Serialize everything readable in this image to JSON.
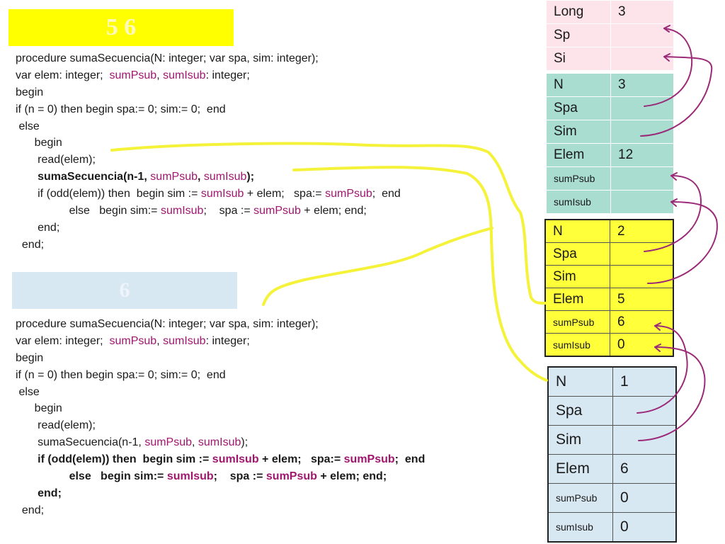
{
  "headings": {
    "top": "5  6",
    "bottom": "6"
  },
  "code_top": [
    [
      {
        "t": "procedure sumaSecuencia(N: integer; var spa, sim: integer);"
      }
    ],
    [
      {
        "t": "var elem: integer;  "
      },
      {
        "t": "sumPsub",
        "k": 1
      },
      {
        "t": ", "
      },
      {
        "t": "sumIsub",
        "k": 1
      },
      {
        "t": ": integer;"
      }
    ],
    [
      {
        "t": "begin"
      }
    ],
    [
      {
        "t": "if (n = 0) then begin spa:= 0; sim:= 0;  end"
      }
    ],
    [
      {
        "t": " else"
      }
    ],
    [
      {
        "t": "      begin"
      }
    ],
    [
      {
        "t": "       read(elem);"
      }
    ],
    [
      {
        "t": "       "
      },
      {
        "t": "sumaSecuencia(n-1, ",
        "b": 1
      },
      {
        "t": "sumPsub",
        "k": 1
      },
      {
        "t": ", ",
        "b": 1
      },
      {
        "t": "sumIsub",
        "k": 1
      },
      {
        "t": ");",
        "b": 1
      }
    ],
    [
      {
        "t": "       if (odd(elem)) then  begin sim := "
      },
      {
        "t": "sumIsub",
        "k": 1
      },
      {
        "t": " + elem;   spa:= "
      },
      {
        "t": "sumPsub",
        "k": 1
      },
      {
        "t": ";  end"
      }
    ],
    [
      {
        "t": "                 else   begin sim:= "
      },
      {
        "t": "sumIsub",
        "k": 1
      },
      {
        "t": ";    spa := "
      },
      {
        "t": "sumPsub",
        "k": 1
      },
      {
        "t": " + elem; end;"
      }
    ],
    [
      {
        "t": "       end;"
      }
    ],
    [
      {
        "t": "  end;"
      }
    ]
  ],
  "code_bottom": [
    [
      {
        "t": "procedure sumaSecuencia(N: integer; var spa, sim: integer);"
      }
    ],
    [
      {
        "t": "var elem: integer;  "
      },
      {
        "t": "sumPsub",
        "k": 1
      },
      {
        "t": ", "
      },
      {
        "t": "sumIsub",
        "k": 1
      },
      {
        "t": ": integer;"
      }
    ],
    [
      {
        "t": "begin"
      }
    ],
    [
      {
        "t": "if (n = 0) then begin spa:= 0; sim:= 0;  end"
      }
    ],
    [
      {
        "t": " else"
      }
    ],
    [
      {
        "t": "      begin"
      }
    ],
    [
      {
        "t": "       read(elem);"
      }
    ],
    [
      {
        "t": "       sumaSecuencia(n-1, "
      },
      {
        "t": "sumPsub",
        "k": 1
      },
      {
        "t": ", "
      },
      {
        "t": "sumIsub",
        "k": 1
      },
      {
        "t": ");"
      }
    ],
    [
      {
        "t": "       if (odd(elem)) then  begin sim := ",
        "b": 1
      },
      {
        "t": "sumIsub",
        "k": 1,
        "b": 1
      },
      {
        "t": " + elem;   spa:= ",
        "b": 1
      },
      {
        "t": "sumPsub",
        "k": 1,
        "b": 1
      },
      {
        "t": ";  end",
        "b": 1
      }
    ],
    [
      {
        "t": "                 else   begin sim:= ",
        "b": 1
      },
      {
        "t": "sumIsub",
        "k": 1,
        "b": 1
      },
      {
        "t": ";    spa := ",
        "b": 1
      },
      {
        "t": "sumPsub",
        "k": 1,
        "b": 1
      },
      {
        "t": " + elem; end;",
        "b": 1
      }
    ],
    [
      {
        "t": "       end;",
        "b": 1
      }
    ],
    [
      {
        "t": "  end;"
      }
    ]
  ],
  "table_long": [
    {
      "name": "Long",
      "value": "3"
    },
    {
      "name": "Sp",
      "value": ""
    },
    {
      "name": "Si",
      "value": ""
    }
  ],
  "table_n3": [
    {
      "name": "N",
      "value": "3"
    },
    {
      "name": "Spa",
      "value": ""
    },
    {
      "name": "Sim",
      "value": ""
    },
    {
      "name": "Elem",
      "value": "12"
    },
    {
      "name": "sumPsub",
      "value": "",
      "small": true
    },
    {
      "name": "sumIsub",
      "value": "",
      "small": true
    }
  ],
  "table_n2": [
    {
      "name": "N",
      "value": "2"
    },
    {
      "name": "Spa",
      "value": ""
    },
    {
      "name": "Sim",
      "value": ""
    },
    {
      "name": "Elem",
      "value": "5"
    },
    {
      "name": "sumPsub",
      "value": "6",
      "small": true
    },
    {
      "name": "sumIsub",
      "value": "0",
      "small": true
    }
  ],
  "table_n1": [
    {
      "name": "N",
      "value": "1"
    },
    {
      "name": "Spa",
      "value": ""
    },
    {
      "name": "Sim",
      "value": ""
    },
    {
      "name": "Elem",
      "value": "6"
    },
    {
      "name": "sumPsub",
      "value": "0",
      "small": true
    },
    {
      "name": "sumIsub",
      "value": "0",
      "small": true
    }
  ],
  "colors": {
    "keyword": "#a0166f",
    "highlight": "#ffff00",
    "annotation_yellow": "#f5f23a",
    "annotation_purple": "#9b2a78"
  }
}
